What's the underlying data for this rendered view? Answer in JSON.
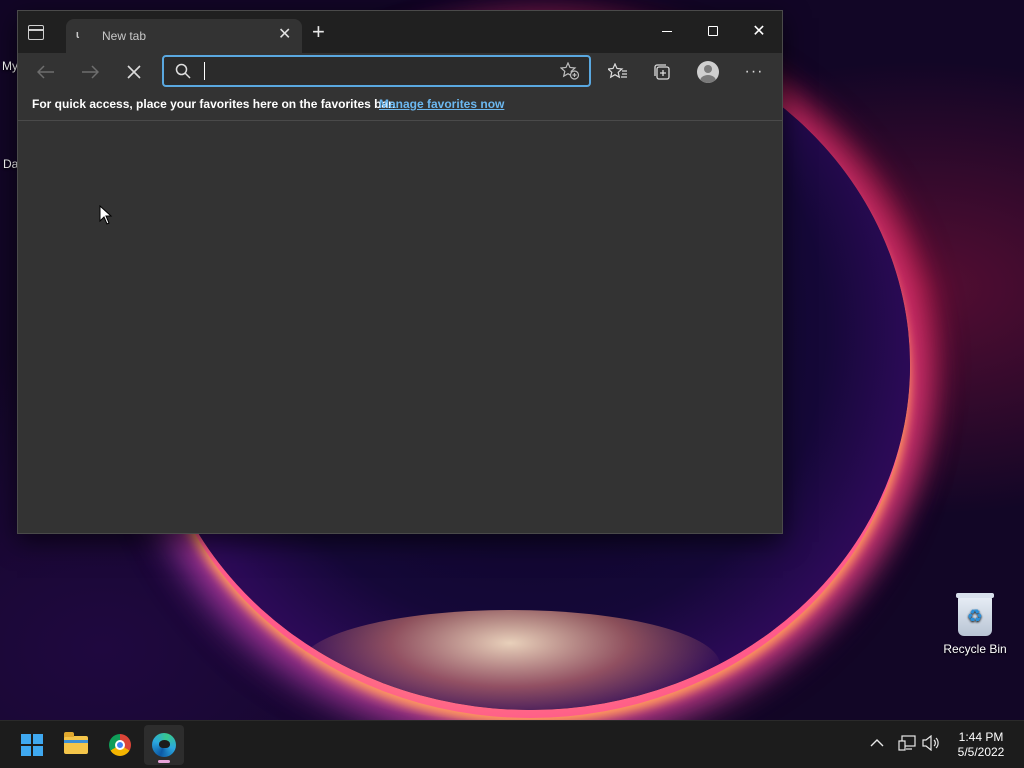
{
  "desktop": {
    "edge_labels": [
      "My",
      "Da"
    ],
    "recycle_bin_label": "Recycle Bin"
  },
  "browser": {
    "tab": {
      "title": "New tab",
      "favicon": "loading-icon"
    },
    "window_controls": {
      "minimize_icon": "minimize-icon",
      "maximize_icon": "maximize-icon",
      "close_icon": "close-icon"
    },
    "toolbar": {
      "back_icon": "back-arrow-icon",
      "forward_icon": "forward-arrow-icon",
      "stop_icon": "stop-icon",
      "address_value": "",
      "address_placeholder": "",
      "favorites_icon": "favorites-icon",
      "collections_icon": "collections-icon",
      "profile_icon": "profile-icon",
      "more_label": "···"
    },
    "favorites_bar": {
      "text": "For quick access, place your favorites here on the favorites bar.",
      "link": "Manage favorites now"
    },
    "accent_color": "#5aa8e0",
    "link_color": "#6cb8f0"
  },
  "taskbar": {
    "apps": [
      {
        "name": "Start",
        "icon": "windows-icon"
      },
      {
        "name": "File Explorer",
        "icon": "folder-icon"
      },
      {
        "name": "Google Chrome",
        "icon": "chrome-icon"
      },
      {
        "name": "Microsoft Edge",
        "icon": "edge-icon",
        "active": true
      }
    ],
    "clock": {
      "time": "1:44 PM",
      "date": "5/5/2022"
    }
  }
}
